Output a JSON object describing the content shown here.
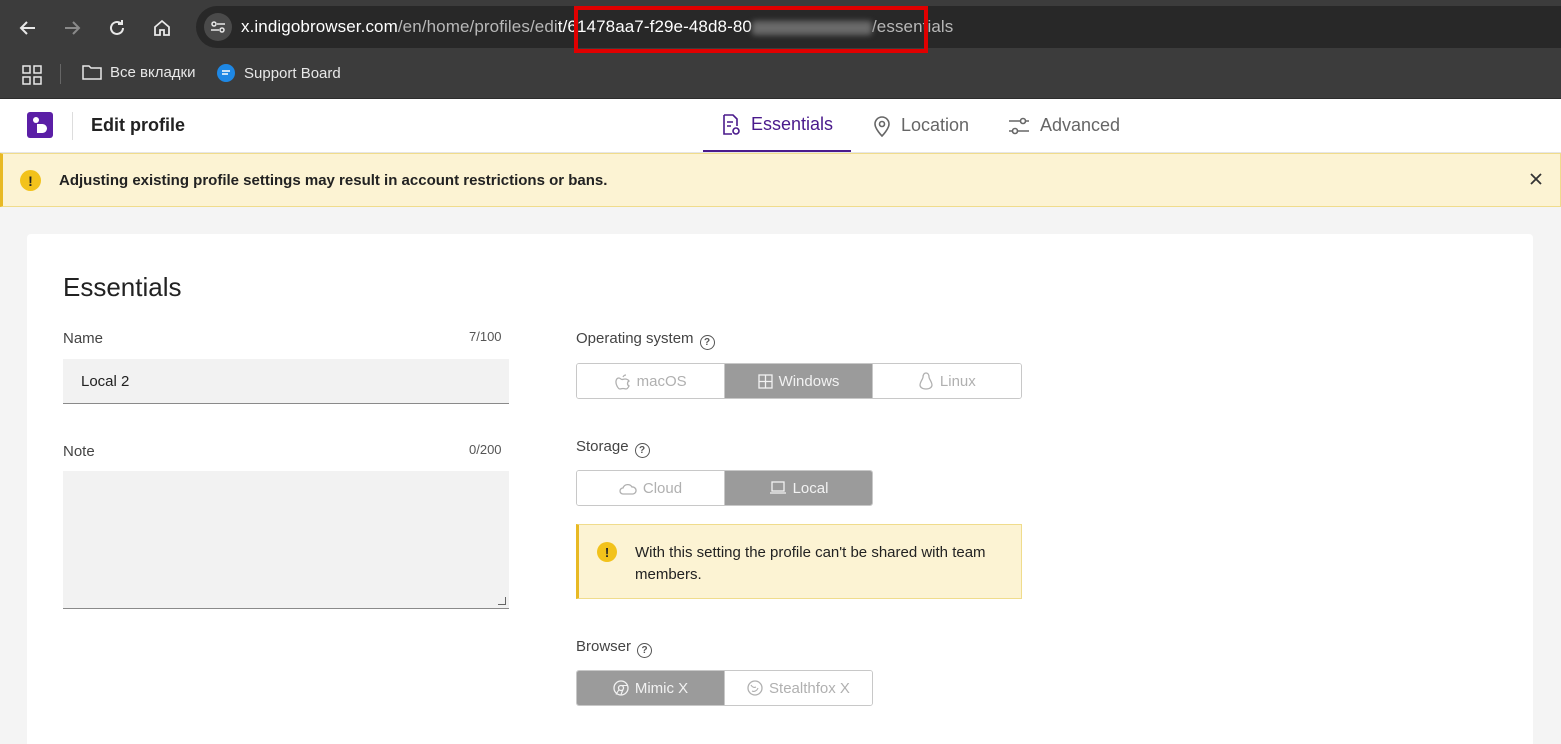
{
  "browser": {
    "url_host": "x.indigobrowser.com",
    "url_path_1": "/en/home/profiles/edi",
    "url_path_2": "t/61478aa7-f29e-48d8-80",
    "url_path_3": "/essentials",
    "bookmarks": [
      {
        "label": "Все вкладки",
        "icon": "folder-icon"
      },
      {
        "label": "Support Board",
        "icon": "chat-icon"
      }
    ]
  },
  "header": {
    "title": "Edit profile",
    "tabs": [
      {
        "label": "Essentials",
        "icon": "document-gear-icon",
        "active": true
      },
      {
        "label": "Location",
        "icon": "location-pin-icon",
        "active": false
      },
      {
        "label": "Advanced",
        "icon": "sliders-icon",
        "active": false
      }
    ]
  },
  "banner": {
    "text": "Adjusting existing profile settings may result in account restrictions or bans.",
    "icon": "warning-icon"
  },
  "essentials": {
    "title": "Essentials",
    "name": {
      "label": "Name",
      "counter": "7/100",
      "value": "Local 2"
    },
    "note": {
      "label": "Note",
      "counter": "0/200",
      "value": ""
    },
    "os": {
      "label": "Operating system",
      "options": [
        {
          "label": "macOS",
          "icon": "apple-icon"
        },
        {
          "label": "Windows",
          "icon": "windows-icon"
        },
        {
          "label": "Linux",
          "icon": "linux-icon"
        }
      ],
      "selected": "Windows"
    },
    "storage": {
      "label": "Storage",
      "options": [
        {
          "label": "Cloud",
          "icon": "cloud-icon"
        },
        {
          "label": "Local",
          "icon": "laptop-icon"
        }
      ],
      "selected": "Local",
      "note": "With this setting the profile can't be shared with team members."
    },
    "browser": {
      "label": "Browser",
      "options": [
        {
          "label": "Mimic X",
          "icon": "chrome-icon"
        },
        {
          "label": "Stealthfox X",
          "icon": "firefox-icon"
        }
      ],
      "selected": "Mimic X"
    }
  },
  "colors": {
    "accent": "#4a1a8c",
    "warning_bg": "#fcf3d3",
    "warning_icon": "#f2c21b",
    "selected_segment": "#9b9b9b",
    "highlight": "#e00000"
  }
}
